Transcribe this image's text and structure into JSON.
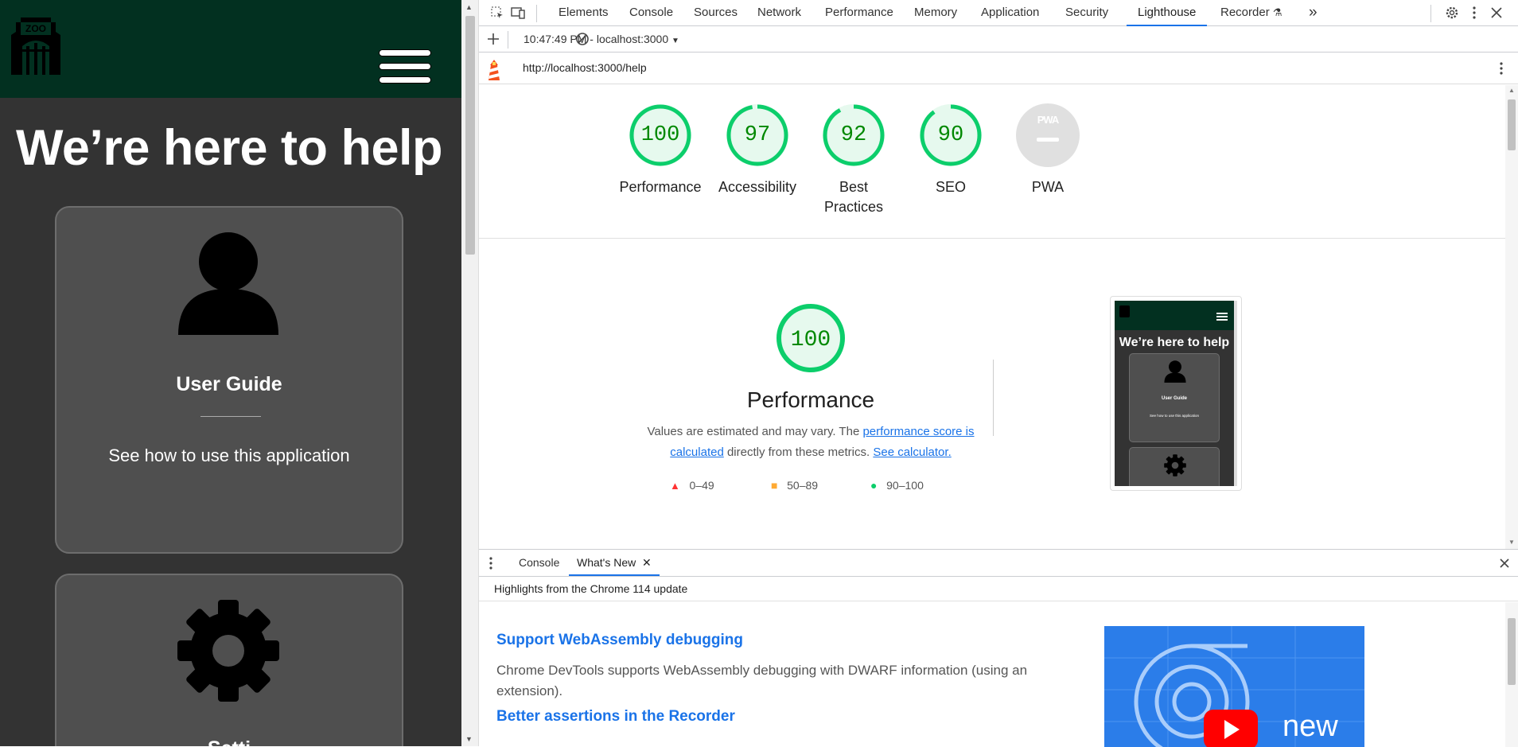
{
  "app": {
    "logo_text": "ZOO",
    "title": "We’re here to help",
    "cards": [
      {
        "title": "User Guide",
        "description": "See how to use this application"
      },
      {
        "title": "Setti"
      }
    ]
  },
  "devtools": {
    "tabs": [
      "Elements",
      "Console",
      "Sources",
      "Network",
      "Performance",
      "Memory",
      "Application",
      "Security",
      "Lighthouse",
      "Recorder"
    ],
    "active_tab": "Lighthouse",
    "more_tabs": "»",
    "report_selector": "10:47:49 PM - localhost:3000",
    "url": "http://localhost:3000/help",
    "scores": [
      {
        "value": "100",
        "label": "Performance",
        "pct": 100
      },
      {
        "value": "97",
        "label": "Accessibility",
        "pct": 97
      },
      {
        "value": "92",
        "label": "Best Practices",
        "pct": 92
      },
      {
        "value": "90",
        "label": "SEO",
        "pct": 90
      },
      {
        "value": "PWA",
        "label": "PWA",
        "pct": 0
      }
    ],
    "performance": {
      "score": "100",
      "title": "Performance",
      "desc_before": "Values are estimated and may vary. The ",
      "desc_link1": "performance score is calculated",
      "desc_middle": " directly from these metrics. ",
      "desc_link2": "See calculator.",
      "legend": [
        {
          "range": "0–49",
          "color": "#ff3333"
        },
        {
          "range": "50–89",
          "color": "#ffaa33"
        },
        {
          "range": "90–100",
          "color": "#0cce6b"
        }
      ]
    },
    "thumbnail": {
      "title": "We’re here to help",
      "card_title": "User Guide",
      "card_desc": "See how to use this application"
    },
    "drawer": {
      "tabs": [
        "Console",
        "What's New"
      ],
      "active_tab": "What's New",
      "subheader": "Highlights from the Chrome 114 update",
      "items": [
        {
          "title": "Support WebAssembly debugging",
          "body": "Chrome DevTools supports WebAssembly debugging with DWARF information (using an extension)."
        },
        {
          "title": "Better assertions in the Recorder"
        }
      ],
      "video_caption": "new"
    }
  },
  "colors": {
    "app_header": "#023020",
    "app_bg": "#333333",
    "card_bg": "#4f4f4f",
    "score_green": "#0cce6b",
    "score_text": "#008800",
    "link_blue": "#1a73e8"
  }
}
